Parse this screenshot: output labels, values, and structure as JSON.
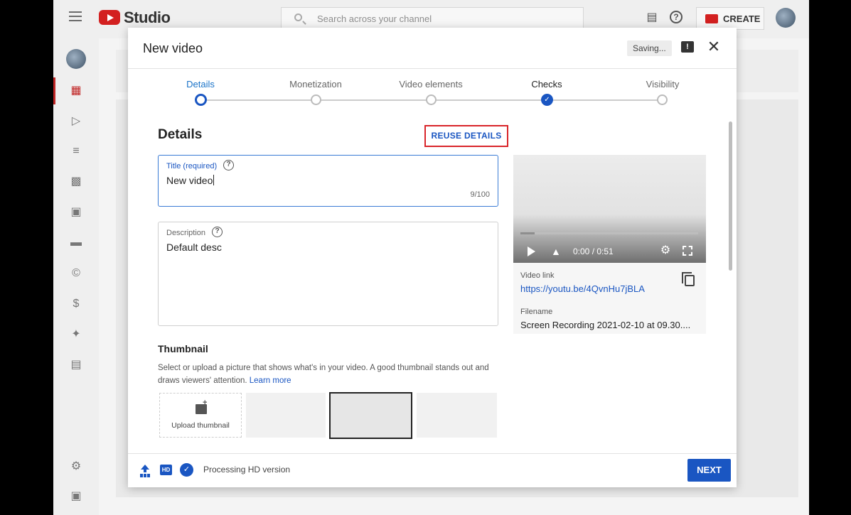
{
  "topbar": {
    "logo_text": "Studio",
    "search_placeholder": "Search across your channel",
    "create_label": "CREATE"
  },
  "dialog": {
    "title": "New video",
    "saving_label": "Saving...",
    "steps": [
      {
        "label": "Details",
        "state": "current"
      },
      {
        "label": "Monetization",
        "state": "pending"
      },
      {
        "label": "Video elements",
        "state": "pending"
      },
      {
        "label": "Checks",
        "state": "done"
      },
      {
        "label": "Visibility",
        "state": "pending"
      }
    ],
    "details_heading": "Details",
    "reuse_label": "REUSE DETAILS",
    "title_field": {
      "label": "Title (required)",
      "value": "New video",
      "counter": "9/100"
    },
    "description_field": {
      "label": "Description",
      "value": "Default desc"
    },
    "thumbnail": {
      "heading": "Thumbnail",
      "description": "Select or upload a picture that shows what's in your video. A good thumbnail stands out and draws viewers' attention.",
      "learn_more": "Learn more",
      "upload_label": "Upload thumbnail"
    },
    "video": {
      "time": "0:00 / 0:51",
      "progress": 0.08,
      "link_label": "Video link",
      "link": "https://youtu.be/4QvnHu7jBLA",
      "filename_label": "Filename",
      "filename": "Screen Recording 2021-02-10 at 09.30...."
    },
    "footer": {
      "status": "Processing HD version",
      "hd_badge": "HD",
      "next_label": "NEXT"
    }
  },
  "colors": {
    "accent": "#1a56c2",
    "highlight_border": "#d9252a",
    "brand_red": "#d32020"
  }
}
